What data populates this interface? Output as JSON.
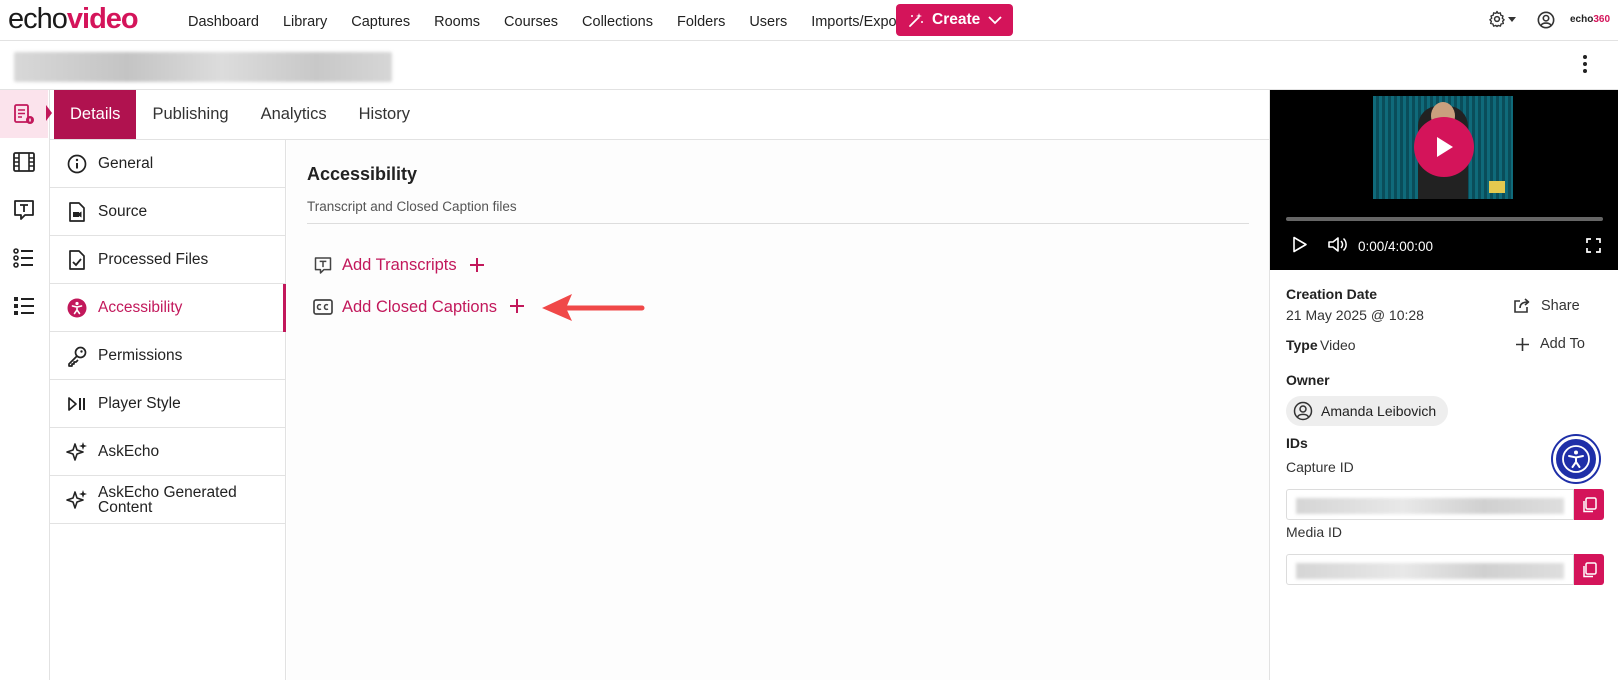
{
  "app": {
    "logo_part1": "echo",
    "logo_part2": "video",
    "brand_small_part1": "echo",
    "brand_small_part2": "360",
    "brand_color": "#d4145a"
  },
  "nav": {
    "items": [
      "Dashboard",
      "Library",
      "Captures",
      "Rooms",
      "Courses",
      "Collections",
      "Folders",
      "Users",
      "Imports/Exports"
    ],
    "create_label": "Create"
  },
  "tabs": [
    {
      "label": "Details",
      "active": true
    },
    {
      "label": "Publishing",
      "active": false
    },
    {
      "label": "Analytics",
      "active": false
    },
    {
      "label": "History",
      "active": false
    }
  ],
  "rail": {
    "icons": [
      "media-details-icon",
      "film-icon",
      "transcript-icon",
      "chapters-icon",
      "list-icon"
    ]
  },
  "menu": {
    "items": [
      {
        "label": "General",
        "icon": "info-icon"
      },
      {
        "label": "Source",
        "icon": "file-video-icon"
      },
      {
        "label": "Processed Files",
        "icon": "file-check-icon"
      },
      {
        "label": "Accessibility",
        "icon": "accessibility-icon",
        "active": true
      },
      {
        "label": "Permissions",
        "icon": "key-icon"
      },
      {
        "label": "Player Style",
        "icon": "play-pause-icon"
      },
      {
        "label": "AskEcho",
        "icon": "sparkle-icon"
      },
      {
        "label": "AskEcho Generated Content",
        "icon": "sparkle-icon"
      }
    ]
  },
  "main": {
    "title": "Accessibility",
    "subtitle": "Transcript and Closed Caption files",
    "add_transcripts": "Add Transcripts",
    "add_captions": "Add Closed Captions"
  },
  "player": {
    "time": "0:00/4:00:00",
    "progress": 0
  },
  "details": {
    "creation_label": "Creation Date",
    "creation_value": "21 May 2025 @ 10:28",
    "type_label": "Type",
    "type_value": "Video",
    "share_label": "Share",
    "add_to_label": "Add To",
    "owner_label": "Owner",
    "owner_name": "Amanda Leibovich",
    "ids_label": "IDs",
    "capture_id_label": "Capture ID",
    "media_id_label": "Media ID"
  }
}
